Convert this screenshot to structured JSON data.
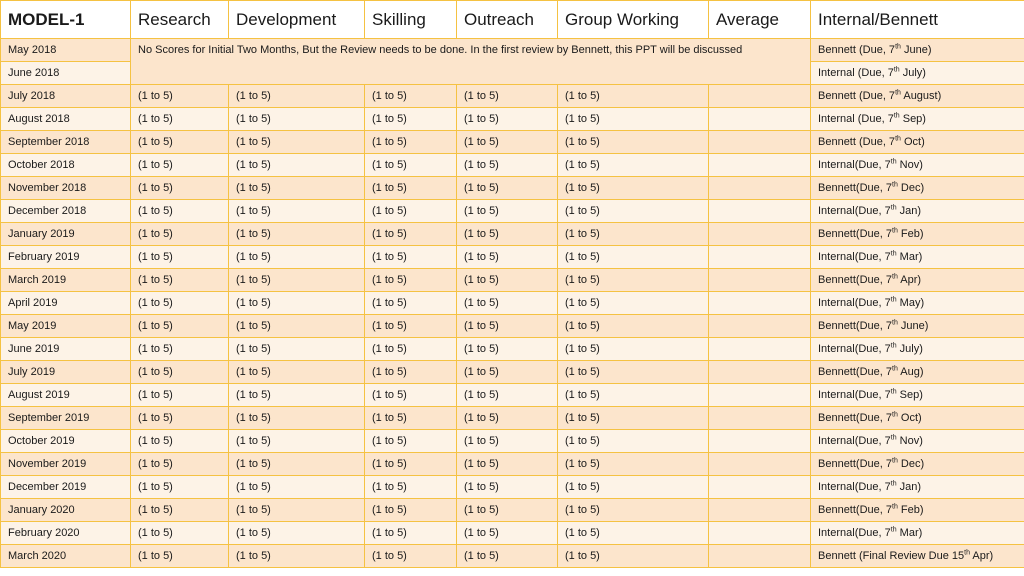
{
  "headers": [
    "MODEL-1",
    "Research",
    "Development",
    "Skilling",
    "Outreach",
    "Group Working",
    "Average",
    "Internal/Bennett"
  ],
  "note": "No Scores for Initial Two Months, But the Review needs to be done. In the first review by Bennett, this PPT will be discussed",
  "score_text": "(1 to 5)",
  "intro_rows": [
    {
      "month": "May 2018",
      "review": {
        "pre": "Bennett (Due, 7",
        "sup": "th",
        "post": " June)"
      }
    },
    {
      "month": "June 2018",
      "review": {
        "pre": "Internal (Due, 7",
        "sup": "th",
        "post": " July)"
      }
    }
  ],
  "rows": [
    {
      "month": "July 2018",
      "review": {
        "pre": "Bennett (Due, 7",
        "sup": "th",
        "post": " August)"
      }
    },
    {
      "month": "August 2018",
      "review": {
        "pre": "Internal (Due, 7",
        "sup": "th",
        "post": " Sep)"
      }
    },
    {
      "month": "September 2018",
      "review": {
        "pre": "Bennett (Due, 7",
        "sup": "th",
        "post": " Oct)"
      }
    },
    {
      "month": "October 2018",
      "review": {
        "pre": "Internal(Due, 7",
        "sup": "th",
        "post": " Nov)"
      }
    },
    {
      "month": "November 2018",
      "review": {
        "pre": "Bennett(Due, 7",
        "sup": "th",
        "post": " Dec)"
      }
    },
    {
      "month": "December 2018",
      "review": {
        "pre": "Internal(Due, 7",
        "sup": "th",
        "post": " Jan)"
      }
    },
    {
      "month": "January 2019",
      "review": {
        "pre": "Bennett(Due, 7",
        "sup": "th",
        "post": " Feb)"
      }
    },
    {
      "month": "February 2019",
      "review": {
        "pre": "Internal(Due, 7",
        "sup": "th",
        "post": " Mar)"
      }
    },
    {
      "month": "March 2019",
      "review": {
        "pre": "Bennett(Due, 7",
        "sup": "th",
        "post": " Apr)"
      }
    },
    {
      "month": "April 2019",
      "review": {
        "pre": "Internal(Due, 7",
        "sup": "th",
        "post": " May)"
      }
    },
    {
      "month": "May 2019",
      "review": {
        "pre": "Bennett(Due, 7",
        "sup": "th",
        "post": " June)"
      }
    },
    {
      "month": "June 2019",
      "review": {
        "pre": "Internal(Due, 7",
        "sup": "th",
        "post": " July)"
      }
    },
    {
      "month": "July 2019",
      "review": {
        "pre": "Bennett(Due, 7",
        "sup": "th",
        "post": " Aug)"
      }
    },
    {
      "month": "August 2019",
      "review": {
        "pre": "Internal(Due, 7",
        "sup": "th",
        "post": " Sep)"
      }
    },
    {
      "month": "September 2019",
      "review": {
        "pre": "Bennett(Due, 7",
        "sup": "th",
        "post": " Oct)"
      }
    },
    {
      "month": "October 2019",
      "review": {
        "pre": "Internal(Due, 7",
        "sup": "th",
        "post": " Nov)"
      }
    },
    {
      "month": "November 2019",
      "review": {
        "pre": "Bennett(Due, 7",
        "sup": "th",
        "post": " Dec)"
      }
    },
    {
      "month": "December 2019",
      "review": {
        "pre": "Internal(Due, 7",
        "sup": "th",
        "post": " Jan)"
      }
    },
    {
      "month": "January 2020",
      "review": {
        "pre": "Bennett(Due, 7",
        "sup": "th",
        "post": " Feb)"
      }
    },
    {
      "month": "February 2020",
      "review": {
        "pre": "Internal(Due, 7",
        "sup": "th",
        "post": " Mar)"
      }
    },
    {
      "month": "March 2020",
      "review": {
        "pre": "Bennett (Final Review Due 15",
        "sup": "th",
        "post": " Apr)"
      }
    }
  ]
}
